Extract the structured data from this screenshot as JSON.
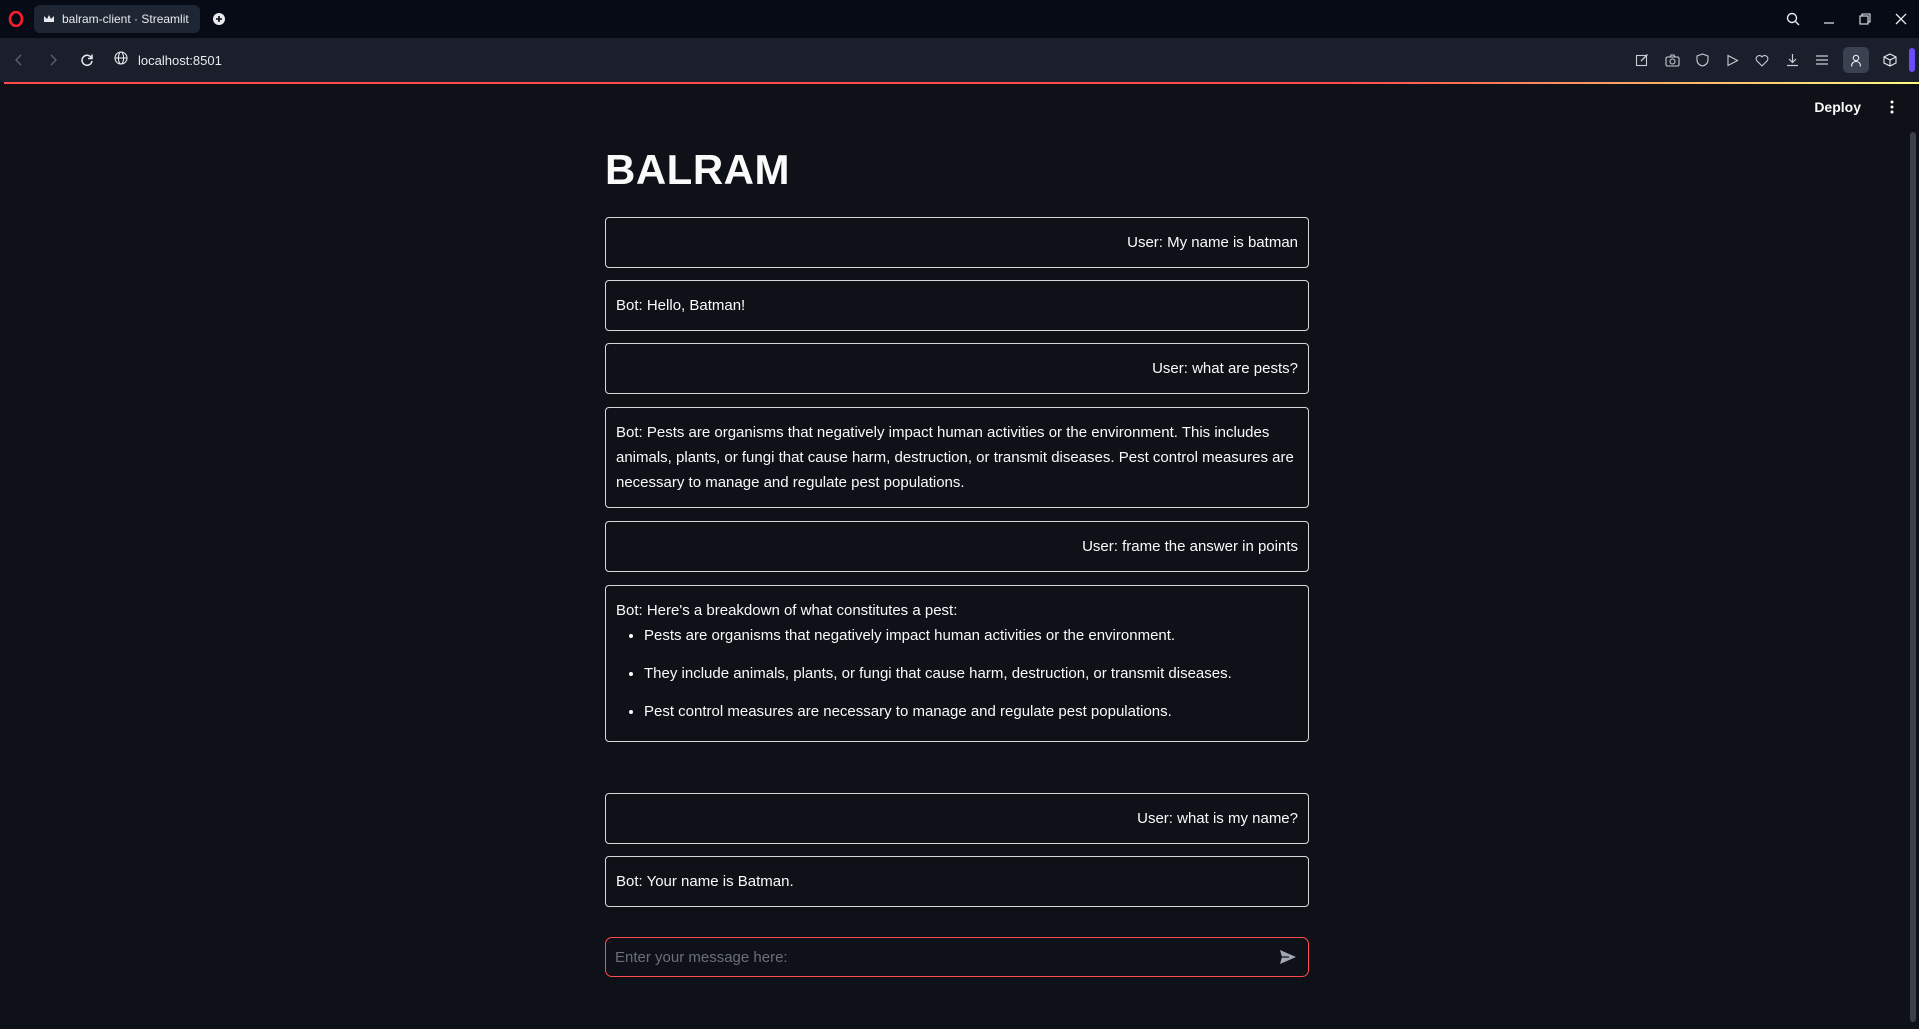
{
  "browser": {
    "tab_title": "balram-client · Streamlit",
    "url": "localhost:8501"
  },
  "app": {
    "deploy_label": "Deploy",
    "title": "BALRAM",
    "messages": [
      {
        "role": "user",
        "text": "User: My name is batman"
      },
      {
        "role": "bot",
        "text": "Bot: Hello, Batman!"
      },
      {
        "role": "user",
        "text": "User: what are pests?"
      },
      {
        "role": "bot",
        "text": "Bot: Pests are organisms that negatively impact human activities or the environment. This includes animals, plants, or fungi that cause harm, destruction, or transmit diseases. Pest control measures are necessary to manage and regulate pest populations."
      },
      {
        "role": "user",
        "text": "User: frame the answer in points"
      },
      {
        "role": "bot",
        "text": "Bot: Here's a breakdown of what constitutes a pest:",
        "points": [
          "Pests are organisms that negatively impact human activities or the environment.",
          "They include animals, plants, or fungi that cause harm, destruction, or transmit diseases.",
          "Pest control measures are necessary to manage and regulate pest populations."
        ]
      },
      {
        "role": "user",
        "text": "User: what is my name?"
      },
      {
        "role": "bot",
        "text": "Bot: Your name is Batman."
      }
    ],
    "input_placeholder": "Enter your message here:",
    "input_value": ""
  },
  "colors": {
    "background": "#0e1117",
    "accent": "#ff4b4b",
    "message_border": "#d8d8d8"
  }
}
